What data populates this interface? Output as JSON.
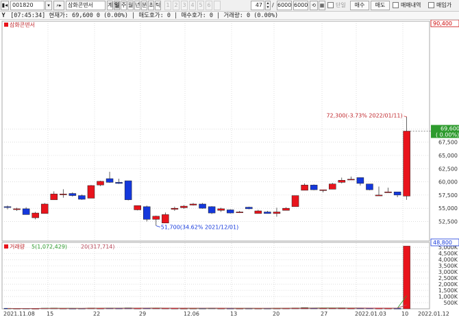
{
  "toolbar": {
    "code": "001820",
    "name": "삼화콘덴서",
    "buttons": [
      "계",
      "일",
      "주",
      "월",
      "년",
      "분",
      "초",
      "틱"
    ],
    "selected_button": "일",
    "num_buttons": [
      "1",
      "2",
      "3",
      "4",
      "5",
      "6"
    ],
    "count": "47",
    "range_a": "6000",
    "range_b": "6000",
    "dan_label": "단일",
    "buy_label": "매수",
    "sell_label": "매도",
    "trade_history_label": "매매내역",
    "trade_input_label": "매입가"
  },
  "infobar": {
    "text": "[07:45:34] 현재가: 69,600 0 (0.00%) | 매도호가: 0 | 매수호가: 0 | 거래량: 0 (0.00%)"
  },
  "price_panel": {
    "title": "삼화콘덴서",
    "current_price": "69,600",
    "current_change": "( 0.00%)",
    "max_label": "90,400",
    "min_label": "48,800",
    "high_annotation": "72,300(-3.73% 2022/01/11)",
    "low_annotation": "51,700(34.62% 2021/12/01)"
  },
  "volume_panel": {
    "legend_title": "거래량",
    "ma5_label": "5(1,072,429)",
    "ma20_label": "20(317,714)"
  },
  "colors": {
    "up": "#e8141c",
    "down": "#1438dc",
    "ma5": "#2e9b2e",
    "ma20": "#b8485a",
    "grid": "#c8c8c8"
  },
  "chart_data": {
    "type": "candlestick",
    "price_ticks": [
      "70,000",
      "67,500",
      "65,000",
      "62,500",
      "60,000",
      "57,500",
      "55,000",
      "52,500"
    ],
    "volume_ticks": [
      "5,000K",
      "4,500K",
      "4,000K",
      "3,500K",
      "3,000K",
      "2,500K",
      "2,000K",
      "1,500K",
      "1,000K",
      "500K"
    ],
    "date_labels": [
      "2021.11.08",
      "15",
      "22",
      "29",
      "12.06",
      "13",
      "20",
      "27",
      "2022.01.03",
      "10",
      "2022.01.12"
    ],
    "candles": [
      {
        "o": 55300,
        "h": 55500,
        "l": 54800,
        "c": 55200
      },
      {
        "o": 54900,
        "h": 55100,
        "l": 54500,
        "c": 54900
      },
      {
        "o": 54900,
        "h": 55200,
        "l": 53800,
        "c": 53800
      },
      {
        "o": 53200,
        "h": 54300,
        "l": 52900,
        "c": 54100
      },
      {
        "o": 54000,
        "h": 56000,
        "l": 54000,
        "c": 55800
      },
      {
        "o": 56600,
        "h": 58200,
        "l": 56600,
        "c": 57700
      },
      {
        "o": 57700,
        "h": 58600,
        "l": 57000,
        "c": 57700
      },
      {
        "o": 57800,
        "h": 58000,
        "l": 57200,
        "c": 57400
      },
      {
        "o": 57400,
        "h": 57600,
        "l": 56600,
        "c": 56700
      },
      {
        "o": 56900,
        "h": 59400,
        "l": 56900,
        "c": 59300
      },
      {
        "o": 59400,
        "h": 60200,
        "l": 59200,
        "c": 60100
      },
      {
        "o": 60600,
        "h": 61900,
        "l": 59800,
        "c": 59900
      },
      {
        "o": 59900,
        "h": 60600,
        "l": 59600,
        "c": 59700
      },
      {
        "o": 60200,
        "h": 60200,
        "l": 56500,
        "c": 56600
      },
      {
        "o": 54700,
        "h": 55500,
        "l": 54600,
        "c": 55500
      },
      {
        "o": 55300,
        "h": 55500,
        "l": 52500,
        "c": 52900
      },
      {
        "o": 52900,
        "h": 53600,
        "l": 51700,
        "c": 53500
      },
      {
        "o": 52200,
        "h": 54200,
        "l": 52200,
        "c": 53800
      },
      {
        "o": 54800,
        "h": 55300,
        "l": 54500,
        "c": 55000
      },
      {
        "o": 55100,
        "h": 55600,
        "l": 54900,
        "c": 55400
      },
      {
        "o": 55600,
        "h": 56000,
        "l": 55500,
        "c": 55800
      },
      {
        "o": 55800,
        "h": 56000,
        "l": 54900,
        "c": 55000
      },
      {
        "o": 55300,
        "h": 55400,
        "l": 53900,
        "c": 54100
      },
      {
        "o": 54600,
        "h": 55100,
        "l": 54300,
        "c": 54900
      },
      {
        "o": 54700,
        "h": 54800,
        "l": 54000,
        "c": 54100
      },
      {
        "o": 54300,
        "h": 54500,
        "l": 54100,
        "c": 54300
      },
      {
        "o": 55200,
        "h": 55300,
        "l": 54800,
        "c": 54900
      },
      {
        "o": 54000,
        "h": 54700,
        "l": 54000,
        "c": 54500
      },
      {
        "o": 54300,
        "h": 54500,
        "l": 54000,
        "c": 54000
      },
      {
        "o": 54000,
        "h": 55100,
        "l": 53400,
        "c": 54300
      },
      {
        "o": 54600,
        "h": 55200,
        "l": 54600,
        "c": 55000
      },
      {
        "o": 55300,
        "h": 57400,
        "l": 55300,
        "c": 57400
      },
      {
        "o": 58400,
        "h": 59700,
        "l": 58400,
        "c": 59400
      },
      {
        "o": 59400,
        "h": 59500,
        "l": 58400,
        "c": 58500
      },
      {
        "o": 58400,
        "h": 58500,
        "l": 58000,
        "c": 58500
      },
      {
        "o": 58600,
        "h": 59800,
        "l": 58600,
        "c": 59600
      },
      {
        "o": 59900,
        "h": 60800,
        "l": 59700,
        "c": 60300
      },
      {
        "o": 60400,
        "h": 61000,
        "l": 60400,
        "c": 60500
      },
      {
        "o": 60800,
        "h": 60800,
        "l": 59300,
        "c": 59700
      },
      {
        "o": 59600,
        "h": 59600,
        "l": 58400,
        "c": 58500
      },
      {
        "o": 57500,
        "h": 59100,
        "l": 57500,
        "c": 57500
      },
      {
        "o": 58100,
        "h": 58900,
        "l": 58000,
        "c": 58100
      },
      {
        "o": 58100,
        "h": 58100,
        "l": 57100,
        "c": 57500
      },
      {
        "o": 57300,
        "h": 72300,
        "l": 56600,
        "c": 69600
      }
    ],
    "volumes": [
      48,
      35,
      42,
      30,
      55,
      60,
      40,
      35,
      38,
      65,
      45,
      70,
      50,
      80,
      45,
      60,
      55,
      50,
      40,
      35,
      42,
      45,
      55,
      38,
      40,
      36,
      45,
      38,
      40,
      48,
      50,
      75,
      95,
      70,
      55,
      60,
      80,
      50,
      60,
      55,
      45,
      40,
      35,
      5100
    ],
    "ma5_volume": [
      20,
      25,
      28,
      30,
      38,
      42,
      45,
      42,
      40,
      48,
      50,
      55,
      52,
      58,
      55,
      60,
      62,
      58,
      52,
      48,
      42,
      40,
      42,
      45,
      44,
      42,
      42,
      40,
      40,
      42,
      45,
      50,
      60,
      68,
      72,
      70,
      68,
      65,
      62,
      58,
      55,
      50,
      45,
      1072
    ],
    "ma20_volume": [
      30,
      31,
      32,
      33,
      34,
      36,
      38,
      40,
      41,
      43,
      44,
      45,
      46,
      48,
      49,
      50,
      51,
      52,
      52,
      52,
      52,
      51,
      50,
      49,
      48,
      47,
      46,
      45,
      45,
      45,
      46,
      47,
      48,
      50,
      51,
      52,
      53,
      54,
      55,
      55,
      55,
      54,
      53,
      318
    ],
    "price_range": [
      48800,
      90400
    ],
    "volume_range": [
      0,
      5400
    ]
  }
}
